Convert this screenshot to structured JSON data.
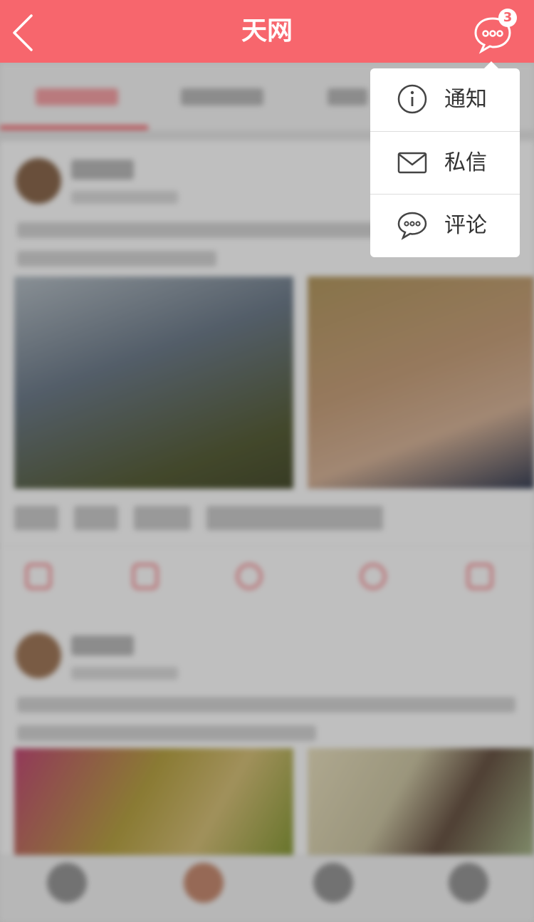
{
  "header": {
    "title": "天网",
    "back_icon": "chevron-left-icon",
    "message_icon": "chat-bubble-icon",
    "badge_count": "3"
  },
  "dropdown": {
    "items": [
      {
        "label": "通知",
        "icon": "info-circle-icon"
      },
      {
        "label": "私信",
        "icon": "envelope-icon"
      },
      {
        "label": "评论",
        "icon": "comment-bubble-icon"
      }
    ]
  },
  "colors": {
    "brand": "#f7666d",
    "overlay": "rgba(0,0,0,0.25)"
  }
}
